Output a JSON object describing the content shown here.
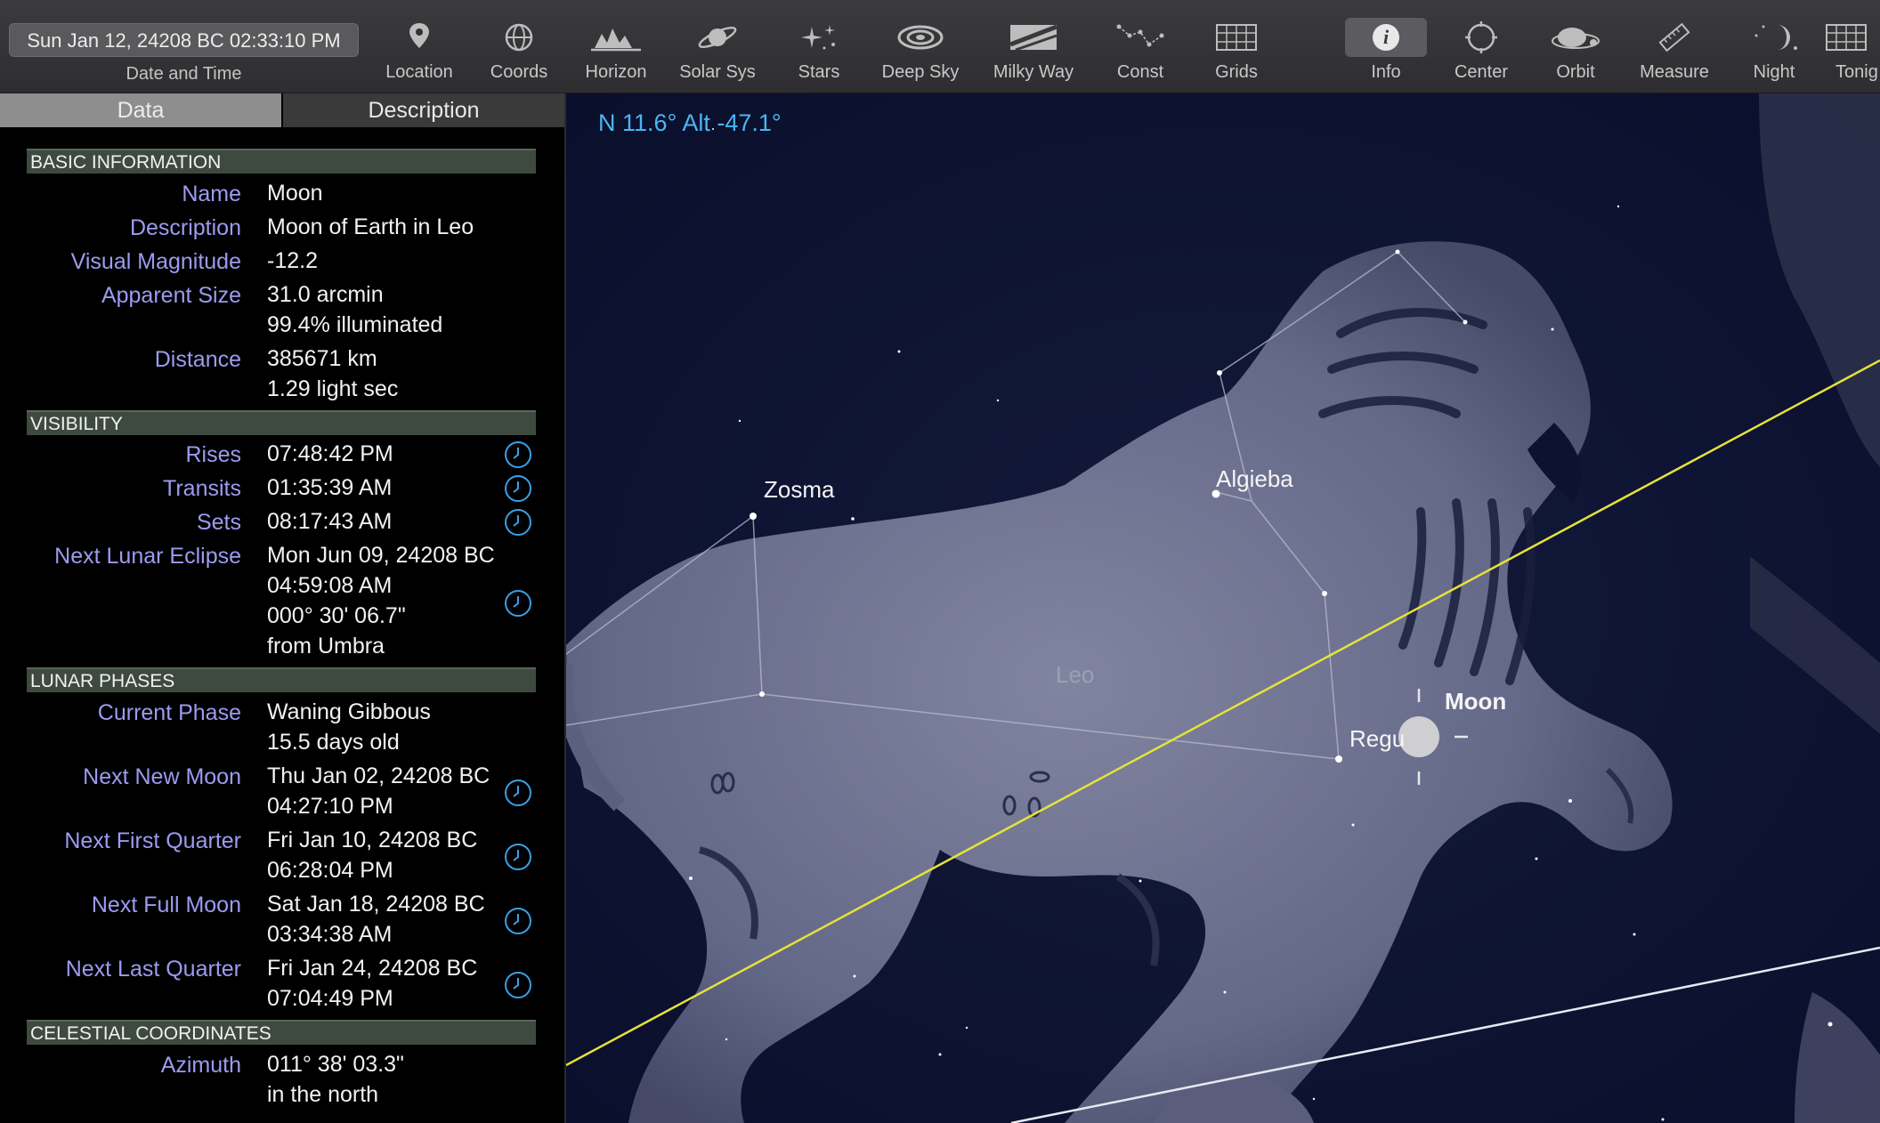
{
  "toolbar": {
    "datetime": "Sun Jan 12, 24208 BC 02:33:10 PM",
    "datetime_label": "Date and Time",
    "buttons": [
      {
        "label": "Location",
        "icon": "location-pin-icon"
      },
      {
        "label": "Coords",
        "icon": "coords-icon"
      },
      {
        "label": "Horizon",
        "icon": "horizon-icon"
      },
      {
        "label": "Solar Sys",
        "icon": "planet-icon"
      },
      {
        "label": "Stars",
        "icon": "stars-icon"
      },
      {
        "label": "Deep Sky",
        "icon": "galaxy-icon"
      },
      {
        "label": "Milky Way",
        "icon": "milky-way-icon"
      },
      {
        "label": "Const",
        "icon": "constellation-icon"
      },
      {
        "label": "Grids",
        "icon": "grid-icon"
      },
      {
        "label": "Info",
        "icon": "info-icon",
        "active": true
      },
      {
        "label": "Center",
        "icon": "center-icon"
      },
      {
        "label": "Orbit",
        "icon": "orbit-icon"
      },
      {
        "label": "Measure",
        "icon": "ruler-icon"
      },
      {
        "label": "Night",
        "icon": "night-moon-icon"
      },
      {
        "label": "Tonig",
        "icon": "calendar-icon"
      }
    ]
  },
  "panel": {
    "tabs": {
      "data": "Data",
      "description": "Description"
    },
    "basic": {
      "header": "BASIC INFORMATION",
      "name_label": "Name",
      "name": "Moon",
      "description_label": "Description",
      "description": "Moon of Earth in Leo",
      "magnitude_label": "Visual Magnitude",
      "magnitude": "-12.2",
      "size_label": "Apparent Size",
      "size": "31.0 arcmin",
      "illuminated": "99.4% illuminated",
      "distance_label": "Distance",
      "distance_km": "385671 km",
      "distance_ls": "1.29 light sec"
    },
    "visibility": {
      "header": "VISIBILITY",
      "rises_label": "Rises",
      "rises": "07:48:42 PM",
      "transits_label": "Transits",
      "transits": "01:35:39 AM",
      "sets_label": "Sets",
      "sets": "08:17:43 AM",
      "eclipse_label": "Next Lunar Eclipse",
      "eclipse_date": "Mon Jun 09, 24208 BC",
      "eclipse_time": "04:59:08 AM",
      "eclipse_sep": "000° 30' 06.7\"",
      "eclipse_from": "from Umbra"
    },
    "phases": {
      "header": "LUNAR PHASES",
      "current_label": "Current Phase",
      "current": "Waning Gibbous",
      "age": "15.5 days old",
      "new_label": "Next New Moon",
      "new_date": "Thu Jan 02, 24208 BC",
      "new_time": "04:27:10 PM",
      "first_label": "Next First Quarter",
      "first_date": "Fri Jan 10, 24208 BC",
      "first_time": "06:28:04 PM",
      "full_label": "Next Full Moon",
      "full_date": "Sat Jan 18, 24208 BC",
      "full_time": "03:34:38 AM",
      "last_label": "Next Last Quarter",
      "last_date": "Fri Jan 24, 24208 BC",
      "last_time": "07:04:49 PM"
    },
    "coords": {
      "header": "CELESTIAL COORDINATES",
      "azimuth_label": "Azimuth",
      "azimuth": "011° 38' 03.3\"",
      "azimuth_dir": "in the north"
    }
  },
  "sky": {
    "readout": "N 11.6° Alt -47.1°",
    "labels": {
      "zosma": "Zosma",
      "algieba": "Algieba",
      "leo": "Leo",
      "moon": "Moon",
      "regulus": "Regu"
    },
    "colors": {
      "background": "#0a0f2c",
      "ecliptic": "#e6e23a",
      "readout": "#4ab6f4",
      "label_blue": "#9d9bf0"
    }
  }
}
